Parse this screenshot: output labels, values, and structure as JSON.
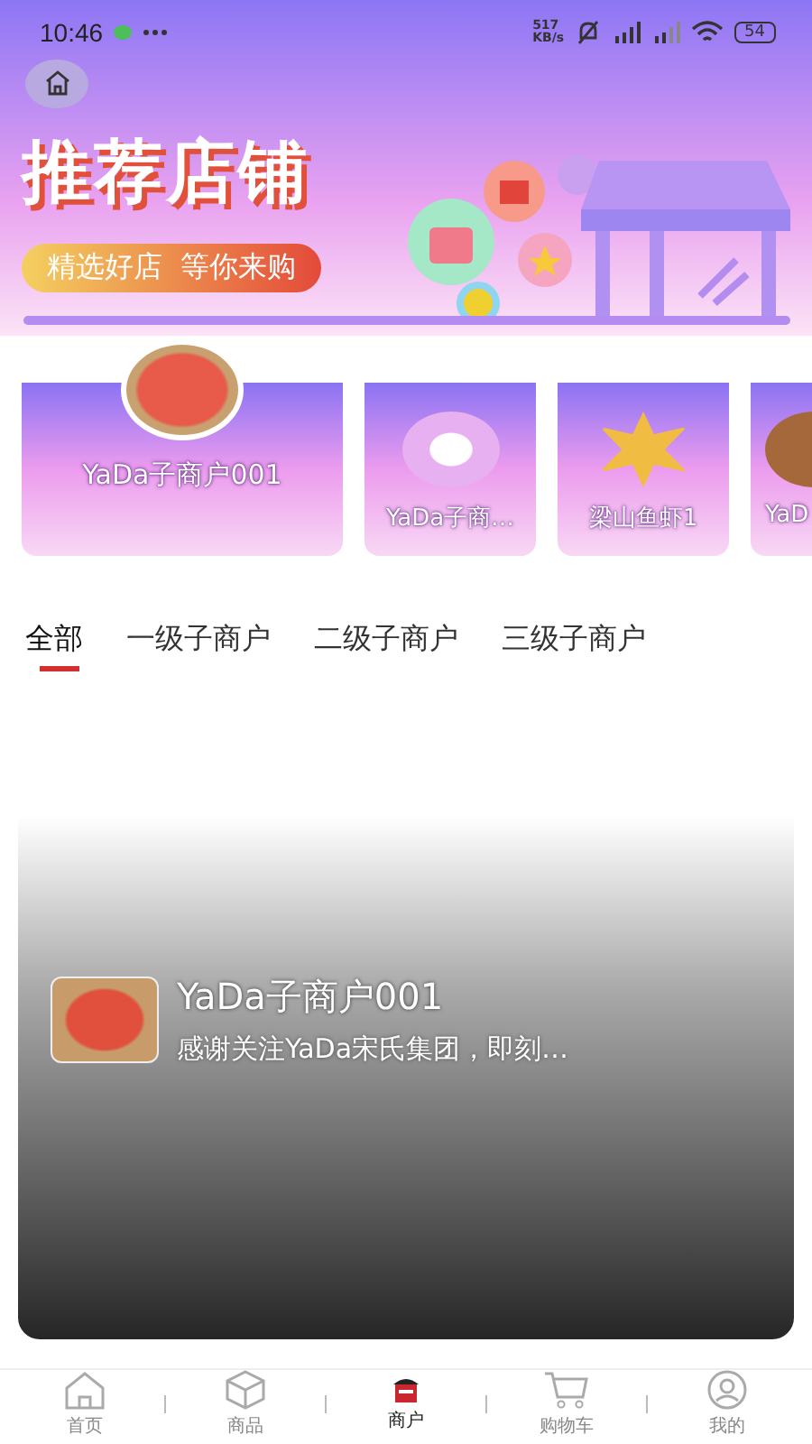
{
  "status_bar": {
    "time": "10:46",
    "net_speed": "517\nKB/s",
    "battery": "54"
  },
  "banner": {
    "title": "推荐店铺",
    "slogan": "精选好店  等你来购"
  },
  "featured_stores": [
    {
      "name": "YaDa子商户001",
      "kind": "wide"
    },
    {
      "name": "YaDa子商…",
      "kind": "narrow"
    },
    {
      "name": "梁山鱼虾1",
      "kind": "narrow"
    },
    {
      "name": "YaD",
      "kind": "narrow"
    }
  ],
  "tabs": [
    {
      "label": "全部",
      "selected": true
    },
    {
      "label": "一级子商户",
      "selected": false
    },
    {
      "label": "二级子商户",
      "selected": false
    },
    {
      "label": "三级子商户",
      "selected": false
    }
  ],
  "store_card": {
    "name": "YaDa子商户001",
    "description": "感谢关注YaDa宋氏集团，即刻…"
  },
  "nav": [
    {
      "label": "首页",
      "selected": false
    },
    {
      "label": "商品",
      "selected": false
    },
    {
      "label": "商户",
      "selected": true
    },
    {
      "label": "购物车",
      "selected": false
    },
    {
      "label": "我的",
      "selected": false
    }
  ]
}
